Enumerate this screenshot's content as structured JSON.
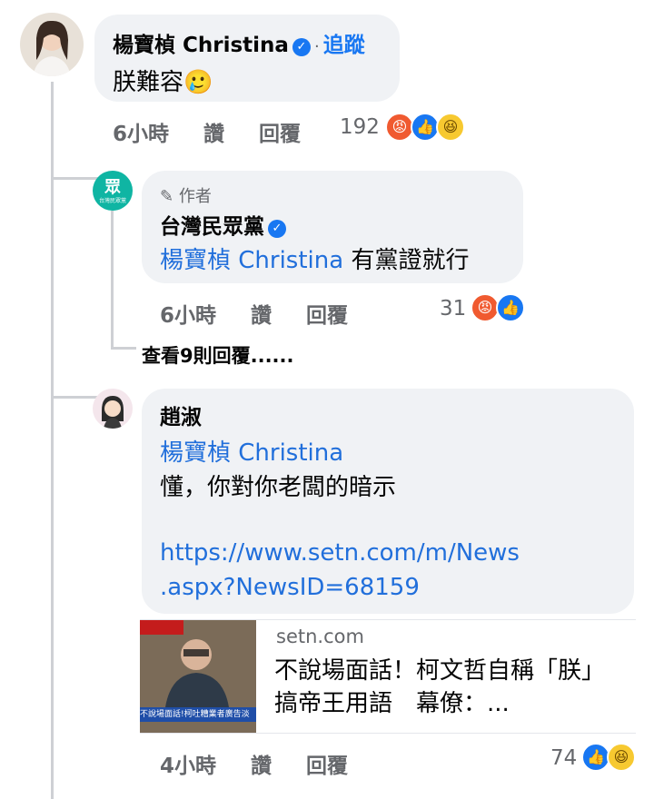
{
  "comments": [
    {
      "author": "楊寶楨 Christina",
      "verified": true,
      "follow_label": "追蹤",
      "text": "朕難容",
      "emoji": "🥲",
      "time": "6小時",
      "like_label": "讚",
      "reply_label": "回覆",
      "reaction_count": "192",
      "reactions": [
        "angry-icon",
        "like-icon",
        "haha-icon"
      ]
    },
    {
      "author_badge": "作者",
      "author": "台灣民眾黨",
      "verified": true,
      "mention": "楊寶楨 Christina",
      "text": "有黨證就行",
      "time": "6小時",
      "like_label": "讚",
      "reply_label": "回覆",
      "reaction_count": "31",
      "reactions": [
        "angry-icon",
        "like-icon"
      ]
    },
    {
      "author": "趙淑",
      "mention": "楊寶楨 Christina",
      "text": "懂，你對你老闆的暗示",
      "link_line1": "https://www.setn.com/m/News",
      "link_line2": ".aspx?NewsID=68159",
      "preview": {
        "domain": "setn.com",
        "title": "不說場面話！柯文哲自稱「朕」搞帝王用語　幕僚：..."
      },
      "time": "4小時",
      "like_label": "讚",
      "reply_label": "回覆",
      "reaction_count": "74",
      "reactions": [
        "like-icon",
        "haha-icon"
      ]
    }
  ],
  "view_replies": "查看9則回覆......",
  "logo_char": "眾",
  "logo_text": "台灣民眾黨",
  "thumb_caption": "不說場面話!柯吐糟業者廣告淡"
}
